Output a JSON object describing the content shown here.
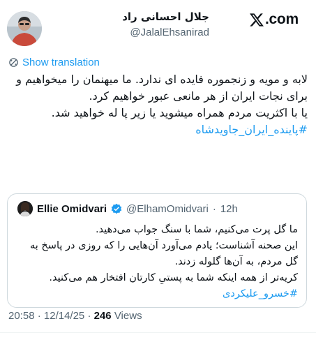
{
  "brand": {
    "suffix": ".com",
    "icon": "x-logo-icon"
  },
  "author": {
    "name": "جلال احسانی راد",
    "handle": "@JalalEhsanirad"
  },
  "translate": {
    "label": "Show translation",
    "icon": "translate-icon"
  },
  "tweet": {
    "lines": [
      "لابه و مویه و زنجموره فایده ای ندارد. ما میهنمان را میخواهیم و برای نجات ایران از هر مانعی عبور خواهیم کرد.",
      "یا با اکثریت مردم همراه میشوید یا زیر پا له خواهید شد."
    ],
    "hashtag": "#پاینده_ایران_جاویدشاه"
  },
  "quote": {
    "name": "Ellie Omidvari",
    "handle": "@ElhamOmidvari",
    "separator": "·",
    "time": "12h",
    "lines": [
      "ما گل پرت می‌کنیم، شما با سنگ جواب می‌دهید.",
      "این صحنه آشناست؛ یادم می‌آورد آن‌هایی را که روزی در پاسخ به گل مردم، به آن‌ها گلوله زدند.",
      "کریه‌تر از همه اینکه شما به پستیِ کارتان افتخار هم می‌کنید."
    ],
    "hashtag": "#خسرو_علیکردی"
  },
  "footer": {
    "time": "20:58",
    "dot1": "·",
    "date": "12/14/25",
    "dot2": "·",
    "views_count": "246",
    "views_label": "Views"
  },
  "colors": {
    "link": "#1d9bf0",
    "text": "#0f1419",
    "muted": "#536471",
    "verified": "#1d9bf0",
    "border": "#cfd9de"
  }
}
